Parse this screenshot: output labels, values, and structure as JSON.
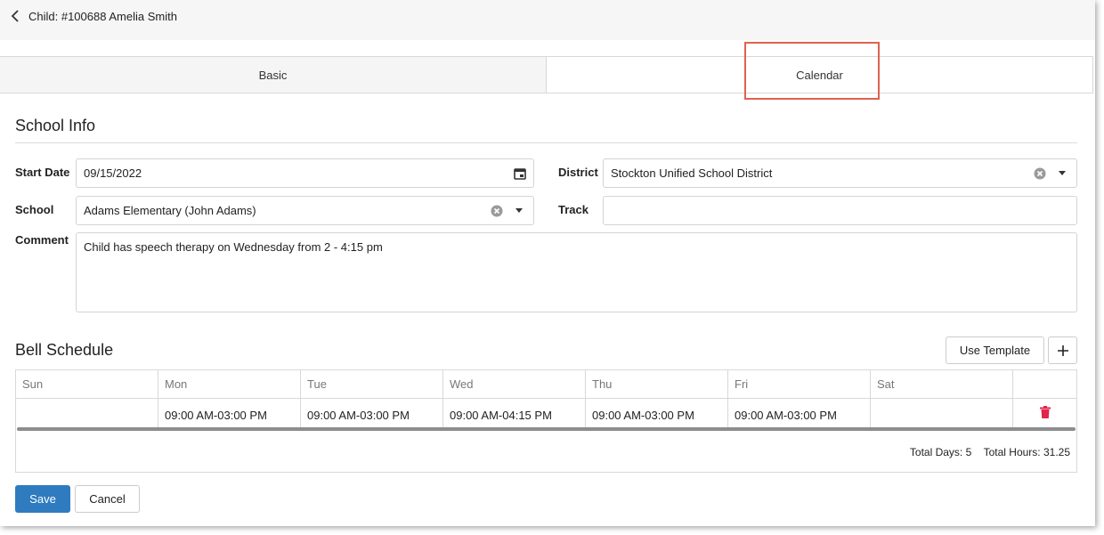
{
  "header": {
    "title": "Child: #100688 Amelia Smith"
  },
  "tabs": [
    {
      "label": "Basic"
    },
    {
      "label": "Calendar"
    }
  ],
  "school_info": {
    "title": "School Info",
    "start_date_label": "Start Date",
    "start_date_value": "09/15/2022",
    "district_label": "District",
    "district_value": "Stockton Unified School District",
    "school_label": "School",
    "school_value": "Adams Elementary (John Adams)",
    "track_label": "Track",
    "track_value": "",
    "comment_label": "Comment",
    "comment_value": "Child has speech therapy on Wednesday from 2 - 4:15 pm"
  },
  "bell_schedule": {
    "title": "Bell Schedule",
    "use_template_label": "Use Template",
    "add_label": "+",
    "days": [
      "Sun",
      "Mon",
      "Tue",
      "Wed",
      "Thu",
      "Fri",
      "Sat"
    ],
    "times": [
      "",
      "09:00 AM-03:00 PM",
      "09:00 AM-03:00 PM",
      "09:00 AM-04:15 PM",
      "09:00 AM-03:00 PM",
      "09:00 AM-03:00 PM",
      ""
    ],
    "total_days": "Total Days: 5",
    "total_hours": "Total Hours: 31.25"
  },
  "actions": {
    "save_label": "Save",
    "cancel_label": "Cancel"
  },
  "icons": {
    "back": "chevron-left-icon",
    "calendar": "calendar-icon",
    "clear": "clear-circle-icon",
    "dropdown": "caret-down-icon",
    "delete": "trash-icon"
  },
  "colors": {
    "primary": "#2f7bbf",
    "highlight": "#e0624f",
    "delete": "#e0244a"
  }
}
